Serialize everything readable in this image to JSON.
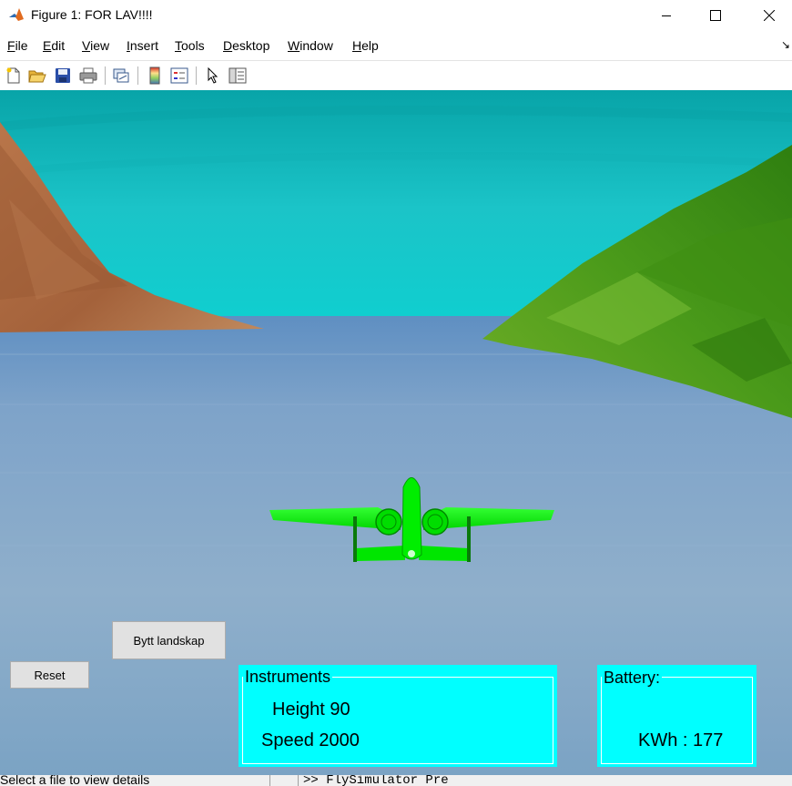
{
  "window": {
    "title": "Figure 1: FOR LAV!!!!",
    "app_icon": "matlab-icon",
    "controls": [
      "minimize-icon",
      "maximize-icon",
      "close-icon"
    ]
  },
  "menu": {
    "items": [
      {
        "pre": "",
        "key": "F",
        "post": "ile"
      },
      {
        "pre": "",
        "key": "E",
        "post": "dit"
      },
      {
        "pre": "",
        "key": "V",
        "post": "iew"
      },
      {
        "pre": "",
        "key": "I",
        "post": "nsert"
      },
      {
        "pre": "",
        "key": "T",
        "post": "ools"
      },
      {
        "pre": "",
        "key": "D",
        "post": "esktop"
      },
      {
        "pre": "",
        "key": "W",
        "post": "indow"
      },
      {
        "pre": "",
        "key": "H",
        "post": "elp"
      }
    ],
    "dock_arrow": "↘"
  },
  "toolbar": {
    "icons": [
      "new-figure-icon",
      "open-file-icon",
      "save-icon",
      "print-icon",
      "link-plot-icon",
      "colorbar-icon",
      "legend-icon",
      "edit-plot-icon",
      "property-inspector-icon"
    ]
  },
  "scene": {
    "sky_color": "#19c3c6",
    "water_color": "#8fb0c8",
    "left_mountain_color": "#a8663d",
    "right_hill_color": "#4f9f1e",
    "aircraft_color": "#00ff00"
  },
  "controls": {
    "bytt_landskap_label": "Bytt landskap",
    "reset_label": "Reset"
  },
  "instruments": {
    "title": "Instruments",
    "height_text": "Height 90",
    "speed_text": "Speed 2000"
  },
  "battery": {
    "title": "Battery:",
    "kwh_text": "KWh : 177"
  },
  "bottom": {
    "status_text": "Select a file to view details",
    "command_text": ">> FlySimulator Pre"
  }
}
